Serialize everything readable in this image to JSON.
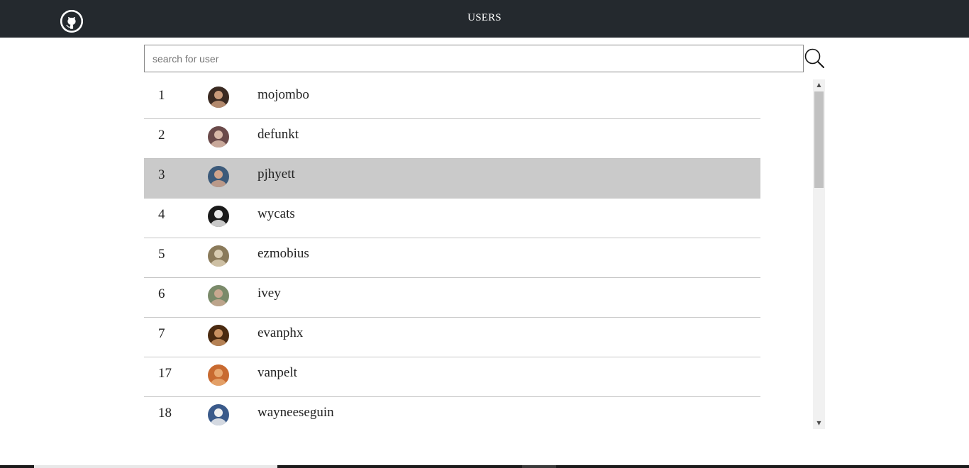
{
  "header": {
    "logo_icon": "github-icon",
    "title": "USERS"
  },
  "search": {
    "placeholder": "search for user",
    "value": "",
    "button_icon": "search-icon"
  },
  "users": [
    {
      "id": "1",
      "login": "mojombo",
      "avatar_colors": [
        "#3a2a22",
        "#c89a7a"
      ]
    },
    {
      "id": "2",
      "login": "defunkt",
      "avatar_colors": [
        "#6a4a4a",
        "#d8b8a8"
      ]
    },
    {
      "id": "3",
      "login": "pjhyett",
      "avatar_colors": [
        "#3c5a7a",
        "#d0a48c"
      ],
      "selected": true
    },
    {
      "id": "4",
      "login": "wycats",
      "avatar_colors": [
        "#1a1a1a",
        "#e8e8e8"
      ]
    },
    {
      "id": "5",
      "login": "ezmobius",
      "avatar_colors": [
        "#8a7a5a",
        "#d8cbb0"
      ]
    },
    {
      "id": "6",
      "login": "ivey",
      "avatar_colors": [
        "#7a8a6a",
        "#c8a890"
      ]
    },
    {
      "id": "7",
      "login": "evanphx",
      "avatar_colors": [
        "#4a2a10",
        "#c89060"
      ]
    },
    {
      "id": "17",
      "login": "vanpelt",
      "avatar_colors": [
        "#c86a30",
        "#e8a870"
      ]
    },
    {
      "id": "18",
      "login": "wayneeseguin",
      "avatar_colors": [
        "#3a5a8a",
        "#f0f0f0"
      ]
    }
  ],
  "colors": {
    "topbar": "#24292e",
    "selected_row": "#cacaca",
    "row_divider": "#c6c6c6"
  }
}
